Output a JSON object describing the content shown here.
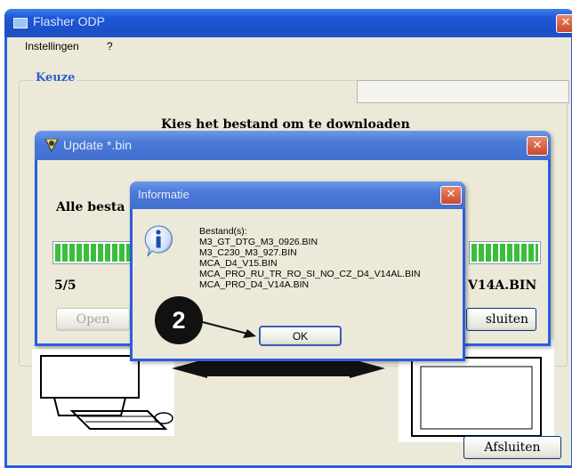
{
  "main_window": {
    "title": "Flasher ODP",
    "menu": [
      "Instellingen",
      "?"
    ],
    "group_title": "Keuze",
    "instruction": "Kies het bestand om te downloaden",
    "close_button": "Afsluiten"
  },
  "update_dialog": {
    "title": "Update *.bin",
    "status_text": "Alle besta",
    "count": "5/5",
    "filename_partial": "V14A.BIN",
    "open_button": "Open",
    "close_button_partial": "sluiten",
    "progress_percent": 100
  },
  "info_dialog": {
    "title": "Informatie",
    "message_header": "Bestand(s):",
    "files": [
      "M3_GT_DTG_M3_0926.BIN",
      "M3_C230_M3_927.BIN",
      "MCA_D4_V15.BIN",
      "MCA_PRO_RU_TR_RO_SI_NO_CZ_D4_V14AL.BIN",
      "MCA_PRO_D4_V14A.BIN"
    ],
    "ok_button": "OK"
  },
  "annotation": {
    "step_number": "2"
  },
  "colors": {
    "xp_blue": "#1f57d6",
    "xp_blue_light": "#3d80f0",
    "xp_face": "#ece9d8",
    "close_red": "#d2553a",
    "callout_black": "#111111"
  },
  "icons": [
    "flasher-app-icon",
    "update-app-icon",
    "info-icon",
    "close-icon"
  ]
}
